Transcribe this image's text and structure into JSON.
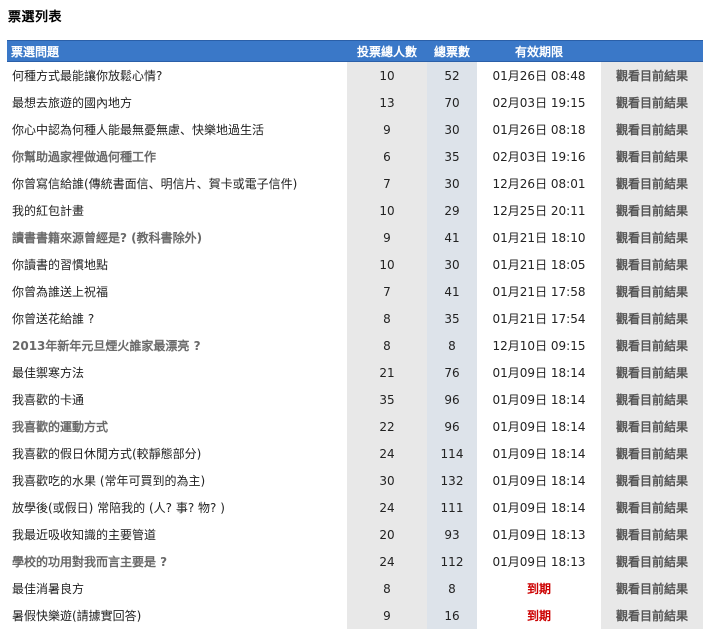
{
  "page_title": "票選列表",
  "headers": {
    "question": "票選問題",
    "voters": "投票總人數",
    "total": "總票數",
    "expiry": "有效期限",
    "action": ""
  },
  "action_label": "觀看目前結果",
  "rows": [
    {
      "q": "何種方式最能讓你放鬆心情?",
      "voters": "10",
      "total": "52",
      "exp": "01月26日 08:48",
      "bold": false,
      "expired": false
    },
    {
      "q": "最想去旅遊的國內地方",
      "voters": "13",
      "total": "70",
      "exp": "02月03日 19:15",
      "bold": false,
      "expired": false
    },
    {
      "q": "你心中認為何種人能最無憂無慮、快樂地過生活",
      "voters": "9",
      "total": "30",
      "exp": "01月26日 08:18",
      "bold": false,
      "expired": false
    },
    {
      "q": "你幫助過家裡做過何種工作",
      "voters": "6",
      "total": "35",
      "exp": "02月03日 19:16",
      "bold": true,
      "expired": false
    },
    {
      "q": "你曾寫信給誰(傳統書面信、明信片、賀卡或電子信件)",
      "voters": "7",
      "total": "30",
      "exp": "12月26日 08:01",
      "bold": false,
      "expired": false
    },
    {
      "q": "我的紅包計畫",
      "voters": "10",
      "total": "29",
      "exp": "12月25日 20:11",
      "bold": false,
      "expired": false
    },
    {
      "q": "讀書書籍來源曾經是? (教科書除外)",
      "voters": "9",
      "total": "41",
      "exp": "01月21日 18:10",
      "bold": true,
      "expired": false
    },
    {
      "q": "你讀書的習慣地點",
      "voters": "10",
      "total": "30",
      "exp": "01月21日 18:05",
      "bold": false,
      "expired": false
    },
    {
      "q": "你曾為誰送上祝福",
      "voters": "7",
      "total": "41",
      "exp": "01月21日 17:58",
      "bold": false,
      "expired": false
    },
    {
      "q": "你曾送花給誰 ?",
      "voters": "8",
      "total": "35",
      "exp": "01月21日 17:54",
      "bold": false,
      "expired": false
    },
    {
      "q": "2013年新年元旦煙火誰家最漂亮 ?",
      "voters": "8",
      "total": "8",
      "exp": "12月10日 09:15",
      "bold": true,
      "expired": false
    },
    {
      "q": "最佳禦寒方法",
      "voters": "21",
      "total": "76",
      "exp": "01月09日 18:14",
      "bold": false,
      "expired": false
    },
    {
      "q": "我喜歡的卡通",
      "voters": "35",
      "total": "96",
      "exp": "01月09日 18:14",
      "bold": false,
      "expired": false
    },
    {
      "q": "我喜歡的運動方式",
      "voters": "22",
      "total": "96",
      "exp": "01月09日 18:14",
      "bold": true,
      "expired": false
    },
    {
      "q": "我喜歡的假日休閒方式(較靜態部分)",
      "voters": "24",
      "total": "114",
      "exp": "01月09日 18:14",
      "bold": false,
      "expired": false
    },
    {
      "q": "我喜歡吃的水果 (常年可買到的為主)",
      "voters": "30",
      "total": "132",
      "exp": "01月09日 18:14",
      "bold": false,
      "expired": false
    },
    {
      "q": "放學後(或假日) 常陪我的 (人? 事? 物? )",
      "voters": "24",
      "total": "111",
      "exp": "01月09日 18:14",
      "bold": false,
      "expired": false
    },
    {
      "q": "我最近吸收知識的主要管道",
      "voters": "20",
      "total": "93",
      "exp": "01月09日 18:13",
      "bold": false,
      "expired": false
    },
    {
      "q": "學校的功用對我而言主要是 ?",
      "voters": "24",
      "total": "112",
      "exp": "01月09日 18:13",
      "bold": true,
      "expired": false
    },
    {
      "q": "最佳消暑良方",
      "voters": "8",
      "total": "8",
      "exp": "到期",
      "bold": false,
      "expired": true
    },
    {
      "q": "暑假快樂遊(請據實回答)",
      "voters": "9",
      "total": "16",
      "exp": "到期",
      "bold": false,
      "expired": true
    }
  ]
}
